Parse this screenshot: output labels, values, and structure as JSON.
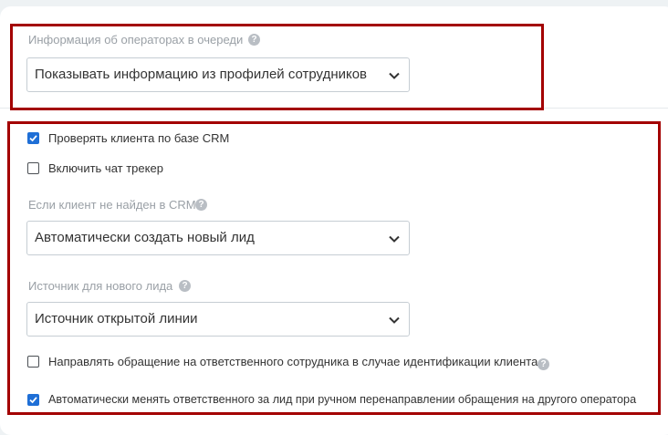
{
  "queue_info": {
    "label": "Информация об операторах в очереди",
    "select_value": "Показывать информацию из профилей сотрудников"
  },
  "crm_check": {
    "label": "Проверять клиента по базе CRM",
    "checked": true
  },
  "chat_tracker": {
    "label": "Включить чат трекер",
    "checked": false
  },
  "not_found": {
    "label": "Если клиент не найден в CRM",
    "select_value": "Автоматически создать новый лид"
  },
  "lead_source": {
    "label": "Источник для нового лида",
    "select_value": "Источник открытой линии"
  },
  "route_to_responsible": {
    "label": "Направлять обращение на ответственного сотрудника в случае идентификации клиента",
    "checked": false
  },
  "auto_change_responsible": {
    "label": "Автоматически менять ответственного за лид при ручном перенаправлении обращения на другого оператора",
    "checked": true
  },
  "icons": {
    "help": "?",
    "chevron": "chevron-down-icon",
    "check": "check-icon"
  },
  "colors": {
    "highlight": "#a30000",
    "checkbox_on": "#1f6fd6"
  }
}
